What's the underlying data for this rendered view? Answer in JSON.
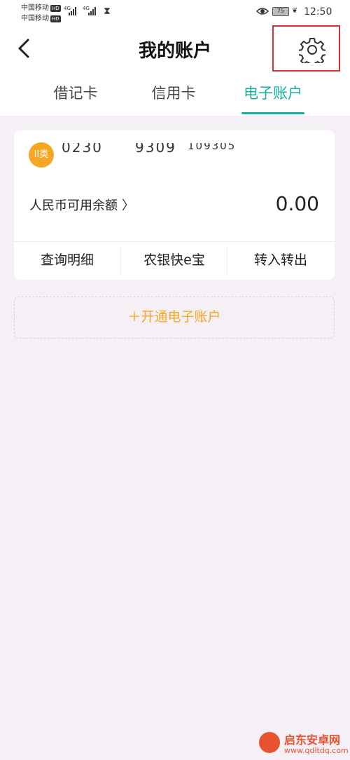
{
  "status_bar": {
    "carrier1": "中国移动",
    "carrier2": "中国移动",
    "hd": "HD",
    "net": "4G",
    "battery": "75",
    "time": "12:50"
  },
  "header": {
    "title": "我的账户",
    "back_icon": "chevron-left-icon",
    "settings_icon": "gear-icon"
  },
  "tabs": [
    {
      "label": "借记卡",
      "active": false
    },
    {
      "label": "信用卡",
      "active": false
    },
    {
      "label": "电子账户",
      "active": true
    }
  ],
  "card": {
    "badge": "II类",
    "account_parts": [
      "0230",
      "9309",
      "109305"
    ],
    "balance_label": "人民币可用余额",
    "balance": "0.00",
    "actions": [
      "查询明细",
      "农银快e宝",
      "转入转出"
    ]
  },
  "open_account": {
    "label": "＋开通电子账户"
  },
  "colors": {
    "accent": "#1aae9e",
    "orange": "#f5a623",
    "highlight": "#d0343a",
    "background": "#f5f0f5"
  },
  "watermark": {
    "name": "启东安卓网",
    "url": "www.qdltdq.com"
  }
}
